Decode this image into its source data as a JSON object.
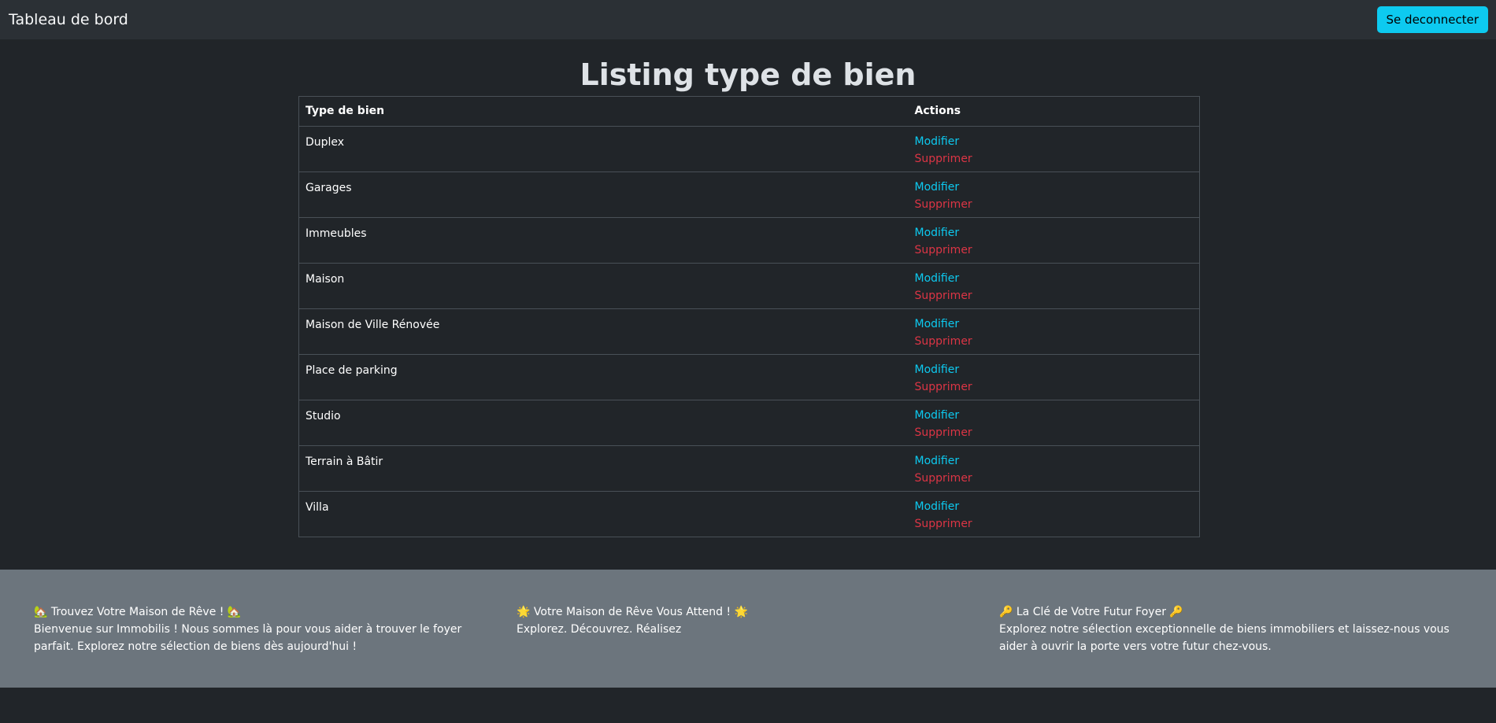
{
  "navbar": {
    "brand": "Tableau de bord",
    "logout_label": "Se deconnecter"
  },
  "main": {
    "title": "Listing type de bien",
    "table": {
      "headers": [
        "Type de bien",
        "Actions"
      ],
      "rows": [
        {
          "type": "Duplex",
          "edit": "Modifier",
          "delete": "Supprimer"
        },
        {
          "type": "Garages",
          "edit": "Modifier",
          "delete": "Supprimer"
        },
        {
          "type": "Immeubles",
          "edit": "Modifier",
          "delete": "Supprimer"
        },
        {
          "type": "Maison",
          "edit": "Modifier",
          "delete": "Supprimer"
        },
        {
          "type": "Maison de Ville Rénovée",
          "edit": "Modifier",
          "delete": "Supprimer"
        },
        {
          "type": "Place de parking",
          "edit": "Modifier",
          "delete": "Supprimer"
        },
        {
          "type": "Studio",
          "edit": "Modifier",
          "delete": "Supprimer"
        },
        {
          "type": "Terrain à Bâtir",
          "edit": "Modifier",
          "delete": "Supprimer"
        },
        {
          "type": "Villa",
          "edit": "Modifier",
          "delete": "Supprimer"
        }
      ]
    }
  },
  "footer": {
    "columns": [
      {
        "title": "🏡 Trouvez Votre Maison de Rêve ! 🏡",
        "text": "Bienvenue sur Immobilis ! Nous sommes là pour vous aider à trouver le foyer parfait. Explorez notre sélection de biens dès aujourd'hui !"
      },
      {
        "title": "🌟 Votre Maison de Rêve Vous Attend ! 🌟",
        "text": "Explorez. Découvrez. Réalisez"
      },
      {
        "title": "🔑 La Clé de Votre Futur Foyer 🔑",
        "text": "Explorez notre sélection exceptionnelle de biens immobiliers et laissez-nous vous aider à ouvrir la porte vers votre futur chez-vous."
      }
    ]
  },
  "colors": {
    "background": "#212529",
    "navbar": "#2b3035",
    "accent_info": "#0dcaf0",
    "danger": "#dc3545",
    "footer": "#6c757d"
  }
}
